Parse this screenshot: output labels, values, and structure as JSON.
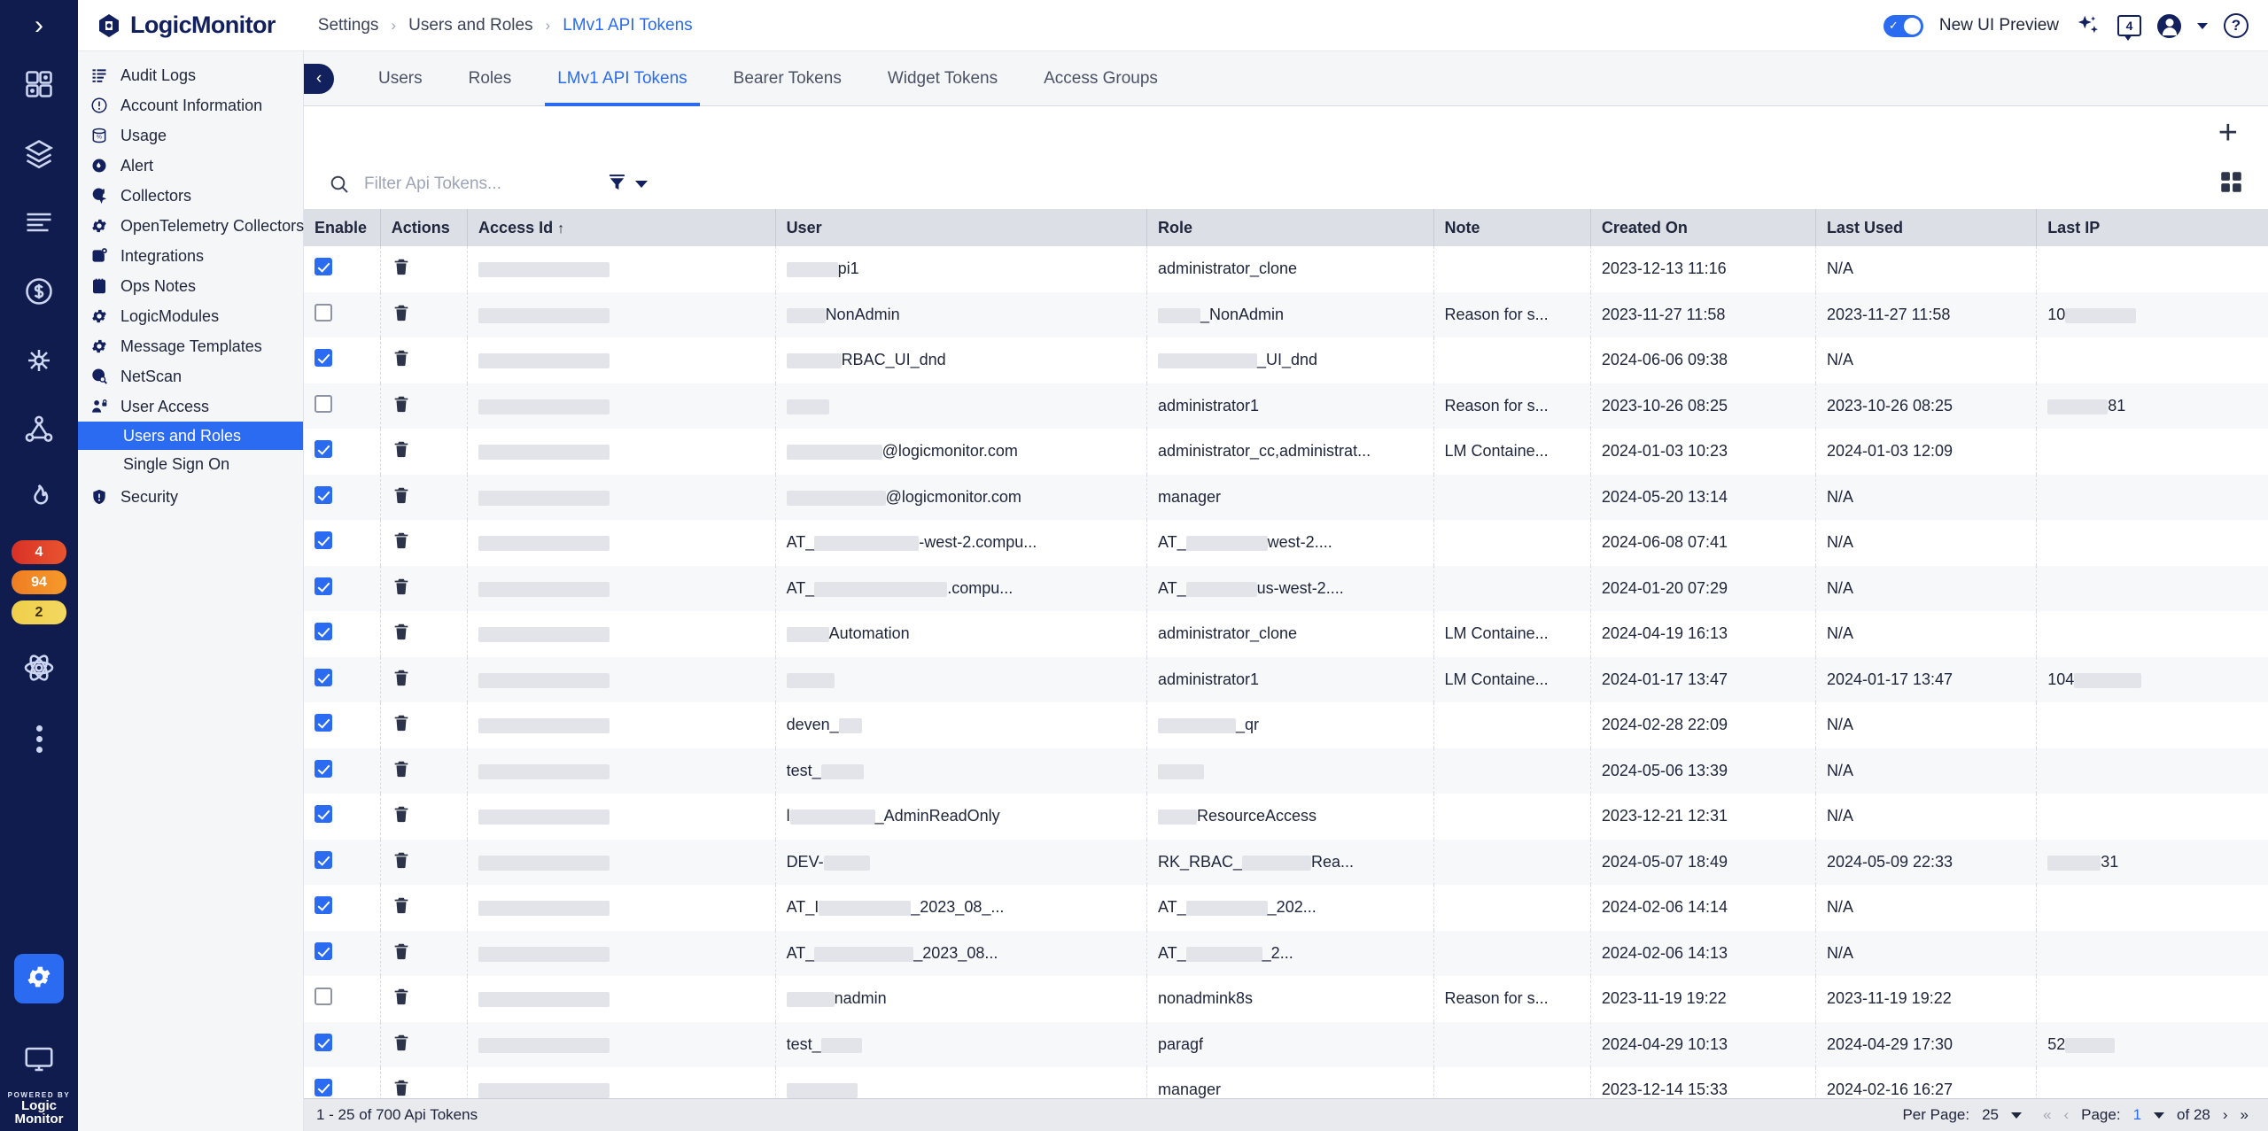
{
  "brand": {
    "name": "LogicMonitor",
    "powered_by": "POWERED BY",
    "footer_line1": "Logic",
    "footer_line2": "Monitor"
  },
  "breadcrumb": {
    "level1": "Settings",
    "level2": "Users and Roles",
    "level3": "LMv1 API Tokens",
    "sep": "›"
  },
  "topbar": {
    "new_ui_label": "New UI Preview",
    "chat_count": "4",
    "help_glyph": "?",
    "toggle_on": true
  },
  "rail": {
    "badges": [
      {
        "value": "4",
        "tone": "red"
      },
      {
        "value": "94",
        "tone": "orange"
      },
      {
        "value": "2",
        "tone": "yellow"
      }
    ]
  },
  "settings_menu": {
    "items": [
      {
        "label": "Audit Logs",
        "icon": "list-icon"
      },
      {
        "label": "Account Information",
        "icon": "info-circle-icon"
      },
      {
        "label": "Usage",
        "icon": "database-percent-icon"
      },
      {
        "label": "Alert",
        "icon": "alert-bell-icon"
      },
      {
        "label": "Collectors",
        "icon": "collector-icon"
      },
      {
        "label": "OpenTelemetry Collectors",
        "icon": "gear-icon"
      },
      {
        "label": "Integrations",
        "icon": "integrations-icon"
      },
      {
        "label": "Ops Notes",
        "icon": "notepad-icon"
      },
      {
        "label": "LogicModules",
        "icon": "gear-icon"
      },
      {
        "label": "Message Templates",
        "icon": "gear-icon"
      },
      {
        "label": "NetScan",
        "icon": "globe-search-icon"
      },
      {
        "label": "User Access",
        "icon": "user-lock-icon"
      }
    ],
    "sub_items": [
      {
        "label": "Users and Roles",
        "selected": true
      },
      {
        "label": "Single Sign On",
        "selected": false
      }
    ],
    "trailing": [
      {
        "label": "Security",
        "icon": "shield-icon"
      }
    ]
  },
  "tabs": [
    {
      "label": "Users",
      "active": false
    },
    {
      "label": "Roles",
      "active": false
    },
    {
      "label": "LMv1 API Tokens",
      "active": true
    },
    {
      "label": "Bearer Tokens",
      "active": false
    },
    {
      "label": "Widget Tokens",
      "active": false
    },
    {
      "label": "Access Groups",
      "active": false
    }
  ],
  "toolbar": {
    "add_glyph": "+"
  },
  "search": {
    "placeholder": "Filter Api Tokens...",
    "value": ""
  },
  "table": {
    "columns": [
      {
        "label": "Enable",
        "sorted": false
      },
      {
        "label": "Actions",
        "sorted": false
      },
      {
        "label": "Access Id",
        "sorted": true,
        "sort_glyph": "↑"
      },
      {
        "label": "User",
        "sorted": false
      },
      {
        "label": "Role",
        "sorted": false
      },
      {
        "label": "Note",
        "sorted": false
      },
      {
        "label": "Created On",
        "sorted": false
      },
      {
        "label": "Last Used",
        "sorted": false
      },
      {
        "label": "Last IP",
        "sorted": false
      }
    ],
    "rows": [
      {
        "enabled": true,
        "access_id_redact": 148,
        "user_pre": "",
        "user_redact": 58,
        "user_post": "pi1",
        "role": "administrator_clone",
        "role_redact": 0,
        "role_post": "",
        "note": "",
        "created_on": "2023-12-13 11:16",
        "last_used": "N/A",
        "last_ip": "",
        "last_ip_redact": 0
      },
      {
        "enabled": false,
        "access_id_redact": 148,
        "user_pre": "",
        "user_redact": 44,
        "user_post": "NonAdmin",
        "role": "",
        "role_redact": 48,
        "role_post": "_NonAdmin",
        "note": "Reason for s...",
        "created_on": "2023-11-27 11:58",
        "last_used": "2023-11-27 11:58",
        "last_ip": "10",
        "last_ip_redact": 80
      },
      {
        "enabled": true,
        "access_id_redact": 148,
        "user_pre": "",
        "user_redact": 62,
        "user_post": "RBAC_UI_dnd",
        "role": "",
        "role_redact": 112,
        "role_post": "_UI_dnd",
        "note": "",
        "created_on": "2024-06-06 09:38",
        "last_used": "N/A",
        "last_ip": "",
        "last_ip_redact": 0
      },
      {
        "enabled": false,
        "access_id_redact": 148,
        "user_pre": "",
        "user_redact": 48,
        "user_post": "",
        "role": "administrator1",
        "role_redact": 0,
        "role_post": "",
        "note": "Reason for s...",
        "created_on": "2023-10-26 08:25",
        "last_used": "2023-10-26 08:25",
        "last_ip": "",
        "last_ip_redact": 68,
        "last_ip_post": "81"
      },
      {
        "enabled": true,
        "access_id_redact": 148,
        "user_pre": "",
        "user_redact": 108,
        "user_post": "@logicmonitor.com",
        "role": "administrator_cc,administrat...",
        "role_redact": 0,
        "role_post": "",
        "note": "LM Containe...",
        "created_on": "2024-01-03 10:23",
        "last_used": "2024-01-03 12:09",
        "last_ip": "",
        "last_ip_redact": 0
      },
      {
        "enabled": true,
        "access_id_redact": 148,
        "user_pre": "",
        "user_redact": 112,
        "user_post": "@logicmonitor.com",
        "role": "manager",
        "role_redact": 0,
        "role_post": "",
        "note": "",
        "created_on": "2024-05-20 13:14",
        "last_used": "N/A",
        "last_ip": "",
        "last_ip_redact": 0
      },
      {
        "enabled": true,
        "access_id_redact": 148,
        "user_pre": "AT_",
        "user_redact": 118,
        "user_post": "-west-2.compu...",
        "role": "AT_",
        "role_redact": 92,
        "role_post": "west-2....",
        "note": "",
        "created_on": "2024-06-08 07:41",
        "last_used": "N/A",
        "last_ip": "",
        "last_ip_redact": 0
      },
      {
        "enabled": true,
        "access_id_redact": 148,
        "user_pre": "AT_",
        "user_redact": 150,
        "user_post": ".compu...",
        "role": "AT_",
        "role_redact": 80,
        "role_post": "us-west-2....",
        "note": "",
        "created_on": "2024-01-20 07:29",
        "last_used": "N/A",
        "last_ip": "",
        "last_ip_redact": 0
      },
      {
        "enabled": true,
        "access_id_redact": 148,
        "user_pre": "",
        "user_redact": 48,
        "user_post": "Automation",
        "role": "administrator_clone",
        "role_redact": 0,
        "role_post": "",
        "note": "LM Containe...",
        "created_on": "2024-04-19 16:13",
        "last_used": "N/A",
        "last_ip": "",
        "last_ip_redact": 0
      },
      {
        "enabled": true,
        "access_id_redact": 148,
        "user_pre": "",
        "user_redact": 54,
        "user_post": "",
        "role": "administrator1",
        "role_redact": 0,
        "role_post": "",
        "note": "LM Containe...",
        "created_on": "2024-01-17 13:47",
        "last_used": "2024-01-17 13:47",
        "last_ip": "104",
        "last_ip_redact": 76
      },
      {
        "enabled": true,
        "access_id_redact": 148,
        "user_pre": "deven_",
        "user_redact": 26,
        "user_post": "",
        "role": "",
        "role_redact": 88,
        "role_post": "_qr",
        "note": "",
        "created_on": "2024-02-28 22:09",
        "last_used": "N/A",
        "last_ip": "",
        "last_ip_redact": 0
      },
      {
        "enabled": true,
        "access_id_redact": 148,
        "user_pre": "test_",
        "user_redact": 48,
        "user_post": "",
        "role": "",
        "role_redact": 52,
        "role_post": "",
        "note": "",
        "created_on": "2024-05-06 13:39",
        "last_used": "N/A",
        "last_ip": "",
        "last_ip_redact": 0
      },
      {
        "enabled": true,
        "access_id_redact": 148,
        "user_pre": "l",
        "user_redact": 96,
        "user_post": "_AdminReadOnly",
        "role": "",
        "role_redact": 44,
        "role_post": "ResourceAccess",
        "note": "",
        "created_on": "2023-12-21 12:31",
        "last_used": "N/A",
        "last_ip": "",
        "last_ip_redact": 0
      },
      {
        "enabled": true,
        "access_id_redact": 148,
        "user_pre": "DEV-",
        "user_redact": 52,
        "user_post": "",
        "role": "RK_RBAC_",
        "role_redact": 78,
        "role_post": "Rea...",
        "note": "",
        "created_on": "2024-05-07 18:49",
        "last_used": "2024-05-09 22:33",
        "last_ip": "",
        "last_ip_redact": 60,
        "last_ip_post": "31"
      },
      {
        "enabled": true,
        "access_id_redact": 148,
        "user_pre": "AT_I",
        "user_redact": 104,
        "user_post": "_2023_08_...",
        "role": "AT_",
        "role_redact": 92,
        "role_post": "_202...",
        "note": "",
        "created_on": "2024-02-06 14:14",
        "last_used": "N/A",
        "last_ip": "",
        "last_ip_redact": 0
      },
      {
        "enabled": true,
        "access_id_redact": 148,
        "user_pre": "AT_",
        "user_redact": 112,
        "user_post": "_2023_08...",
        "role": "AT_",
        "role_redact": 86,
        "role_post": "_2...",
        "note": "",
        "created_on": "2024-02-06 14:13",
        "last_used": "N/A",
        "last_ip": "",
        "last_ip_redact": 0
      },
      {
        "enabled": false,
        "access_id_redact": 148,
        "user_pre": "",
        "user_redact": 54,
        "user_post": "nadmin",
        "role": "nonadmink8s",
        "role_redact": 0,
        "role_post": "",
        "note": "Reason for s...",
        "created_on": "2023-11-19 19:22",
        "last_used": "2023-11-19 19:22",
        "last_ip": "",
        "last_ip_redact": 0
      },
      {
        "enabled": true,
        "access_id_redact": 148,
        "user_pre": "test_",
        "user_redact": 46,
        "user_post": "",
        "role": "paragf",
        "role_redact": 0,
        "role_post": "",
        "note": "",
        "created_on": "2024-04-29 10:13",
        "last_used": "2024-04-29 17:30",
        "last_ip": "52",
        "last_ip_redact": 56
      },
      {
        "enabled": true,
        "access_id_redact": 148,
        "user_pre": "",
        "user_redact": 80,
        "user_post": "",
        "role": "manager",
        "role_redact": 0,
        "role_post": "",
        "note": "",
        "created_on": "2023-12-14 15:33",
        "last_used": "2024-02-16 16:27",
        "last_ip": "",
        "last_ip_redact": 0
      }
    ]
  },
  "footer": {
    "count_text": "1 - 25 of 700 Api Tokens",
    "per_page_label": "Per Page:",
    "per_page_value": "25",
    "page_label": "Page:",
    "page_value": "1",
    "of_label": "of 28",
    "first_glyph": "«",
    "prev_glyph": "‹",
    "next_glyph": "›",
    "last_glyph": "»"
  },
  "colors": {
    "brand_navy": "#13205e",
    "accent_blue": "#2a6bf2",
    "rail_bg": "#111c4e",
    "header_bg": "#dcdfe6",
    "panel_bg": "#f5f6f8"
  }
}
